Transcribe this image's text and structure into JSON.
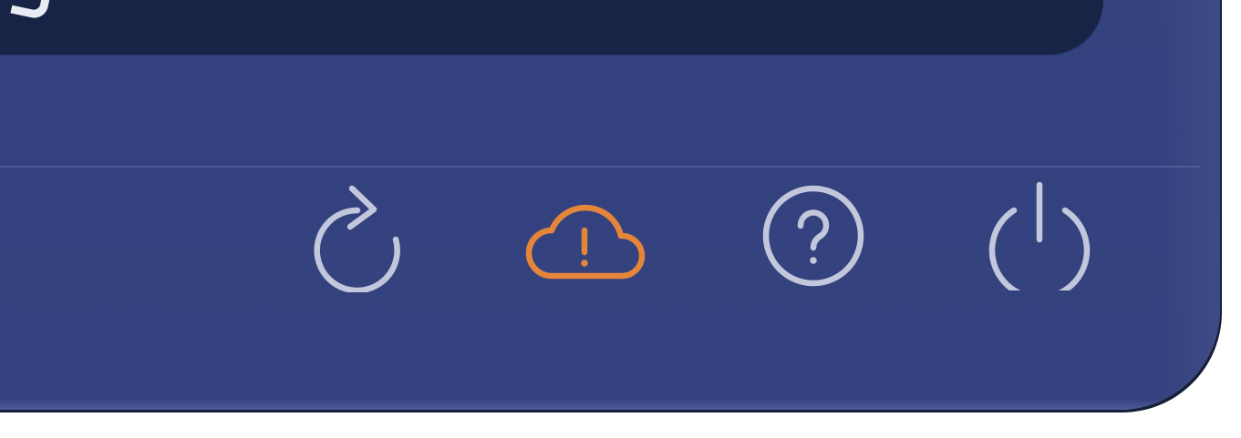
{
  "colors": {
    "background": "#34427e",
    "top_panel": "#182445",
    "icon_default": "#c3c7db",
    "icon_warning": "#e4853a"
  },
  "toolbar": {
    "buttons": [
      {
        "id": "refresh",
        "icon": "refresh-icon"
      },
      {
        "id": "cloud-warning",
        "icon": "cloud-alert-icon"
      },
      {
        "id": "help",
        "icon": "help-circle-icon"
      },
      {
        "id": "power",
        "icon": "power-icon"
      }
    ]
  }
}
